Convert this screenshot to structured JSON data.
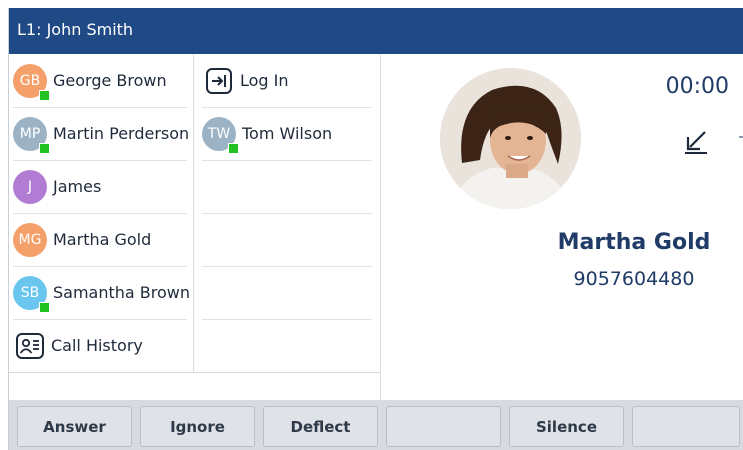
{
  "header": {
    "line_title": "L1: John Smith"
  },
  "contacts_col1": [
    {
      "initials": "GB",
      "name": "George Brown",
      "color": "#f5a06a",
      "presence": true
    },
    {
      "initials": "MP",
      "name": "Martin Perderson",
      "color": "#9bb3c4",
      "presence": true
    },
    {
      "initials": "J",
      "name": "James",
      "color": "#b27bd4",
      "presence": false
    },
    {
      "initials": "MG",
      "name": "Martha Gold",
      "color": "#f5a06a",
      "presence": false
    },
    {
      "initials": "SB",
      "name": "Samantha Brown",
      "color": "#6ac6ee",
      "presence": true
    },
    {
      "icon": "contact-card-icon",
      "name": "Call History"
    }
  ],
  "contacts_col2": [
    {
      "icon": "login-icon",
      "name": "Log In"
    },
    {
      "initials": "TW",
      "name": "Tom Wilson",
      "color": "#9bb3c4",
      "presence": true
    }
  ],
  "call": {
    "timer": "00:00",
    "direction_icon": "incoming-call-arrow-icon",
    "caller_name": "Martha Gold",
    "caller_number": "9057604480",
    "photo": "caller-photo"
  },
  "softkeys": [
    "Answer",
    "Ignore",
    "Deflect",
    "",
    "Silence",
    ""
  ],
  "colors": {
    "header_bg": "#1f4a85",
    "presence_available": "#22c222",
    "text_primary": "#1f3b66",
    "softkey_bar": "#d7dade"
  }
}
